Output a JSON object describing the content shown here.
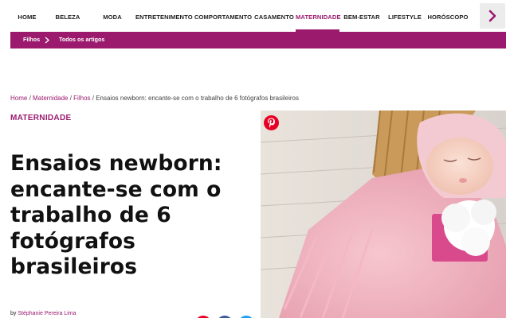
{
  "topnav": {
    "items": [
      "HOME",
      "BELEZA",
      "MODA",
      "ENTRETENIMENTO",
      "COMPORTAMENTO",
      "CASAMENTO",
      "MATERNIDADE",
      "BEM-ESTAR",
      "LIFESTYLE",
      "HORÓSCOPO"
    ],
    "active": "MATERNIDADE"
  },
  "subnav": {
    "items": [
      "Filhos",
      "Todos os artigos"
    ]
  },
  "breadcrumb": {
    "home": "Home",
    "maternidade": "Maternidade",
    "filhos": "Filhos",
    "sep": " / ",
    "current": "Ensaios newborn: encante-se com o trabalho de 6 fotógrafos brasileiros"
  },
  "article": {
    "category": "MATERNIDADE",
    "title": "Ensaios newborn: encante-se com o trabalho de 6 fotógrafos brasileiros",
    "byline_prefix": "by ",
    "author": "Stéphanie Pereira Lima"
  },
  "icons": {
    "next": "chevron-right-icon",
    "pinterest": "pinterest-icon",
    "submenu_sep": "chevron-right-icon"
  },
  "colors": {
    "accent": "#9b1a6e",
    "pinterest": "#e60023",
    "facebook": "#3b5998",
    "twitter": "#1da1f2"
  }
}
